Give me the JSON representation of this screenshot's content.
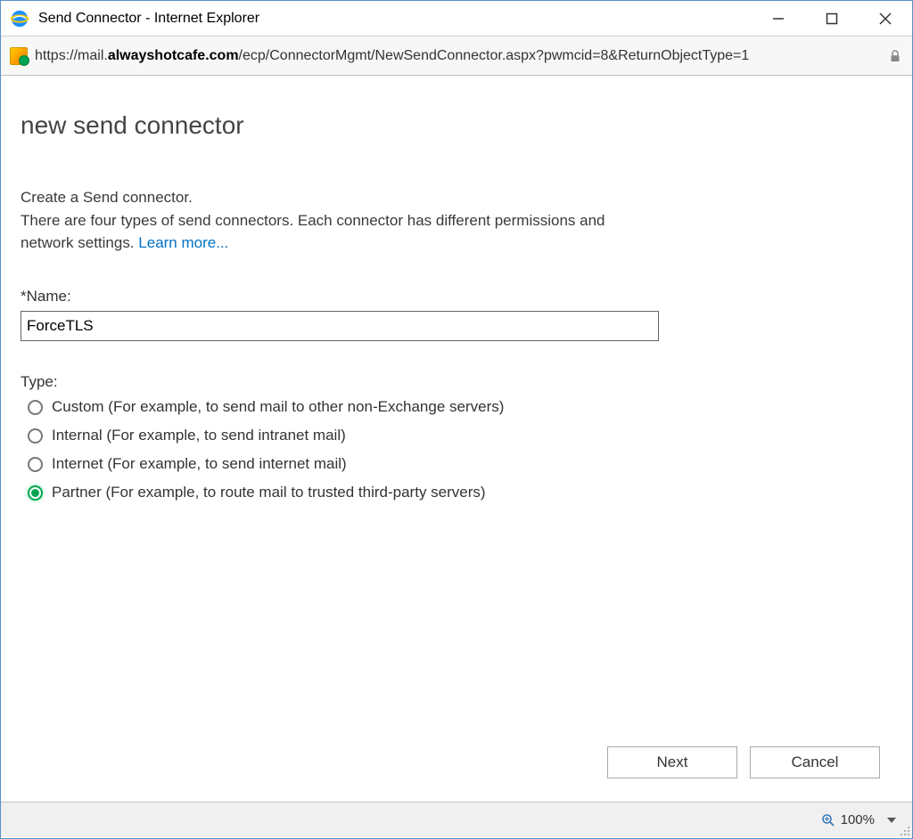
{
  "window": {
    "title": "Send Connector - Internet Explorer"
  },
  "url": {
    "scheme": "https://",
    "prefix": "mail.",
    "domain": "alwayshotcafe.com",
    "path": "/ecp/ConnectorMgmt/NewSendConnector.aspx?pwmcid=8&ReturnObjectType=1"
  },
  "page": {
    "heading": "new send connector",
    "intro_line": "Create a Send connector.",
    "intro_detail_prefix": "There are four types of send connectors. Each connector has different permissions and network settings. ",
    "learn_more": "Learn more...",
    "name_label": "*Name:",
    "name_value": "ForceTLS",
    "type_label": "Type:",
    "type_options": [
      {
        "label": "Custom (For example, to send mail to other non-Exchange servers)",
        "selected": false
      },
      {
        "label": "Internal (For example, to send intranet mail)",
        "selected": false
      },
      {
        "label": "Internet (For example, to send internet mail)",
        "selected": false
      },
      {
        "label": "Partner (For example, to route mail to trusted third-party servers)",
        "selected": true
      }
    ]
  },
  "buttons": {
    "next": "Next",
    "cancel": "Cancel"
  },
  "statusbar": {
    "zoom": "100%"
  }
}
